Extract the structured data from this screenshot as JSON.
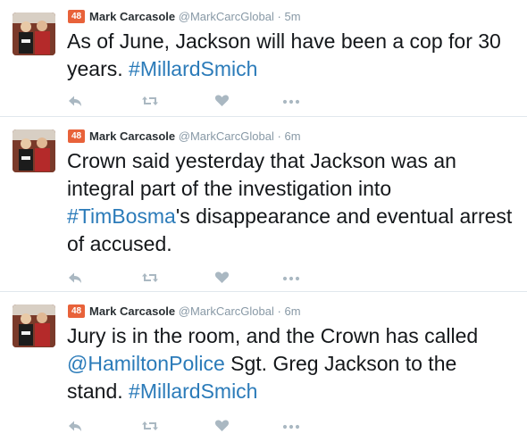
{
  "tweets": [
    {
      "author": {
        "name": "Mark Carcasole",
        "handle": "@MarkCarcGlobal",
        "badge": "48"
      },
      "separator": "·",
      "time": "5m",
      "segments": [
        {
          "text": "As of June, Jackson will have been a cop for 30 years. ",
          "link": false
        },
        {
          "text": "#MillardSmich",
          "link": true
        }
      ]
    },
    {
      "author": {
        "name": "Mark Carcasole",
        "handle": "@MarkCarcGlobal",
        "badge": "48"
      },
      "separator": "·",
      "time": "6m",
      "segments": [
        {
          "text": "Crown said yesterday that Jackson was an integral part of the investigation into ",
          "link": false
        },
        {
          "text": "#TimBosma",
          "link": true
        },
        {
          "text": "'s disappearance and eventual arrest of accused.",
          "link": false
        }
      ]
    },
    {
      "author": {
        "name": "Mark Carcasole",
        "handle": "@MarkCarcGlobal",
        "badge": "48"
      },
      "separator": "·",
      "time": "6m",
      "segments": [
        {
          "text": "Jury is in the room, and the Crown has called ",
          "link": false
        },
        {
          "text": "@HamiltonPolice",
          "link": true
        },
        {
          "text": " Sgt. Greg Jackson to the stand. ",
          "link": false
        },
        {
          "text": "#MillardSmich",
          "link": true
        }
      ]
    }
  ],
  "icons": {
    "reply": "reply-icon",
    "retweet": "retweet-icon",
    "like": "heart-icon",
    "more": "more-icon"
  },
  "colors": {
    "link": "#2b7bb9",
    "badge": "#e8623a",
    "meta": "#8899a6",
    "icon": "#aab8c2",
    "divider": "#e1e8ed"
  }
}
